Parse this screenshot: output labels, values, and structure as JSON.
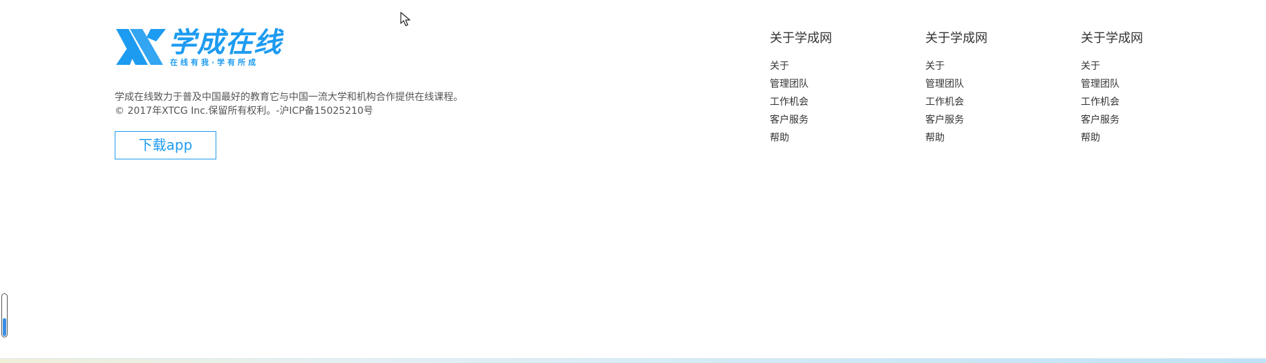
{
  "logo": {
    "title": "学成在线",
    "slogan": "在线有我·学有所成",
    "brand_color": "#1d9bf0"
  },
  "description": {
    "line1": "学成在线致力于普及中国最好的教育它与中国一流大学和机构合作提供在线课程。",
    "line2": "© 2017年XTCG Inc.保留所有权利。-沪ICP备15025210号"
  },
  "download_button": {
    "label": "下载app"
  },
  "link_columns": [
    {
      "title": "关于学成网",
      "items": [
        "关于",
        "管理团队",
        "工作机会",
        "客户服务",
        "帮助"
      ]
    },
    {
      "title": "关于学成网",
      "items": [
        "关于",
        "管理团队",
        "工作机会",
        "客户服务",
        "帮助"
      ]
    },
    {
      "title": "关于学成网",
      "items": [
        "关于",
        "管理团队",
        "工作机会",
        "客户服务",
        "帮助"
      ]
    }
  ],
  "icons": {
    "logo_mark": "xc-logo-mark-icon",
    "cursor": "mouse-pointer-icon"
  },
  "scroll_indicator": {
    "level": 0.45,
    "fill_color": "#3a8ee6"
  }
}
